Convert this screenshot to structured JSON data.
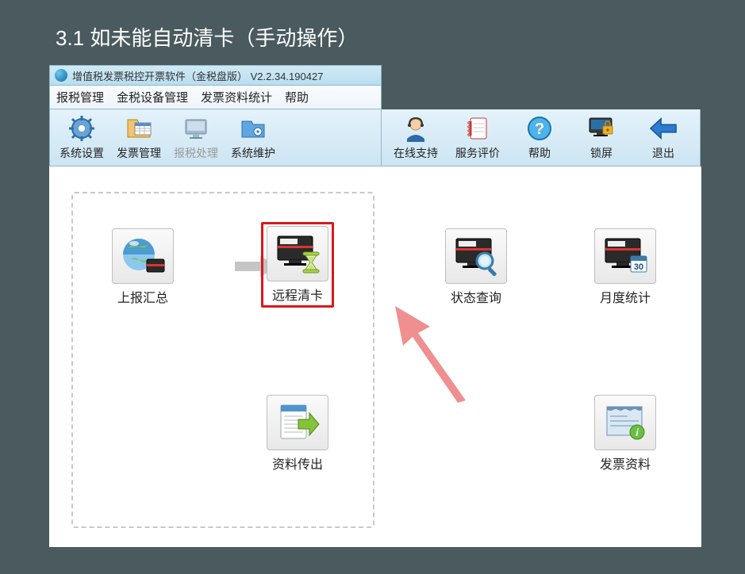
{
  "slide": {
    "title": "3.1  如未能自动清卡（手动操作）"
  },
  "window": {
    "title": "增值税发票税控开票软件（金税盘版） V2.2.34.190427"
  },
  "menu": {
    "items": [
      "报税管理",
      "金税设备管理",
      "发票资料统计",
      "帮助"
    ]
  },
  "toolbarLeft": {
    "items": [
      {
        "name": "system-settings",
        "label": "系统设置"
      },
      {
        "name": "invoice-manage",
        "label": "发票管理"
      },
      {
        "name": "tax-report",
        "label": "报税处理",
        "dim": true
      },
      {
        "name": "system-maint",
        "label": "系统维护"
      }
    ]
  },
  "toolbarRight": {
    "items": [
      {
        "name": "online-support",
        "label": "在线支持"
      },
      {
        "name": "service-rating",
        "label": "服务评价"
      },
      {
        "name": "help",
        "label": "帮助"
      },
      {
        "name": "lock-screen",
        "label": "锁屏"
      },
      {
        "name": "exit",
        "label": "退出"
      }
    ]
  },
  "tiles": {
    "report_summary": "上报汇总",
    "remote_clear": "远程清卡",
    "status_query": "状态查询",
    "monthly_stats": "月度统计",
    "data_export": "资料传出",
    "invoice_data": "发票资料"
  }
}
